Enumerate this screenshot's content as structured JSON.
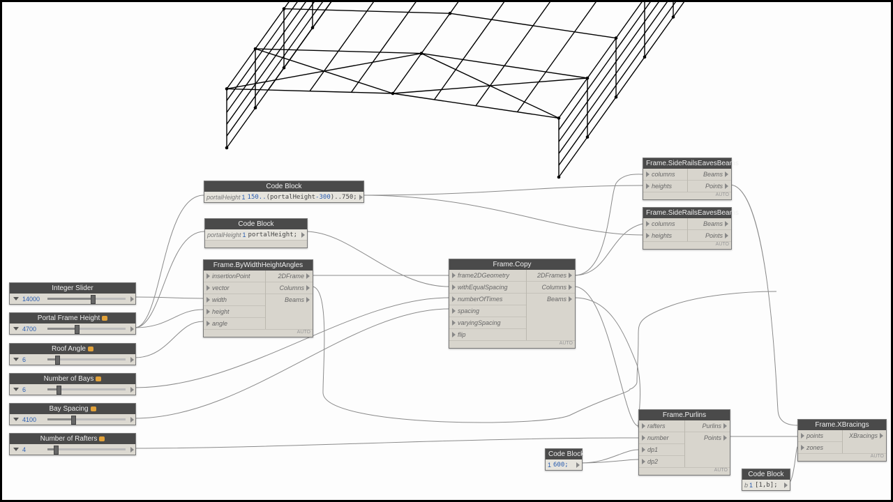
{
  "sliders": [
    {
      "label": "Integer Slider",
      "value": "14000",
      "fill": 0.55,
      "badge": false
    },
    {
      "label": "Portal Frame Height",
      "value": "4700",
      "fill": 0.35,
      "badge": true
    },
    {
      "label": "Roof Angle",
      "value": "6",
      "fill": 0.1,
      "badge": true
    },
    {
      "label": "Number of Bays",
      "value": "6",
      "fill": 0.12,
      "badge": true
    },
    {
      "label": "Bay Spacing",
      "value": "4100",
      "fill": 0.3,
      "badge": true
    },
    {
      "label": "Number of Rafters",
      "value": "4",
      "fill": 0.08,
      "badge": true
    }
  ],
  "cb1": {
    "title": "Code Block",
    "inLabel": "portalHeight",
    "ln": "1",
    "code_a": "150..",
    "code_b": "(portalHeight",
    "code_c": "-300",
    "code_d": ")..750;"
  },
  "cb2": {
    "title": "Code Block",
    "inLabel": "portalHeight",
    "ln": "1",
    "code": "portalHeight;"
  },
  "cb3": {
    "title": "Code Block",
    "ln": "1",
    "code": "600;"
  },
  "cb4": {
    "title": "Code Block",
    "inLabel": "b",
    "ln": "1",
    "code": "[1,b];"
  },
  "frameBy": {
    "title": "Frame.ByWidthHeightAngles",
    "ins": [
      "insertionPoint",
      "vector",
      "width",
      "height",
      "angle"
    ],
    "outs": [
      "2DFrame",
      "Columns",
      "Beams"
    ]
  },
  "frameCopy": {
    "title": "Frame.Copy",
    "ins": [
      "frame2DGeometry",
      "withEqualSpacing",
      "numberOfTimes",
      "spacing",
      "varyingSpacing",
      "flip"
    ],
    "outs": [
      "2DFrames",
      "Columns",
      "Beams"
    ]
  },
  "sre1": {
    "title": "Frame.SideRailsEavesBeams",
    "ins": [
      "columns",
      "heights"
    ],
    "outs": [
      "Beams",
      "Points"
    ]
  },
  "sre2": {
    "title": "Frame.SideRailsEavesBeams",
    "ins": [
      "columns",
      "heights"
    ],
    "outs": [
      "Beams",
      "Points"
    ]
  },
  "purlins": {
    "title": "Frame.Purlins",
    "ins": [
      "rafters",
      "number",
      "dp1",
      "dp2"
    ],
    "outs": [
      "Purlins",
      "Points"
    ]
  },
  "xbrac": {
    "title": "Frame.XBracings",
    "ins": [
      "points",
      "zones"
    ],
    "outs": [
      "XBracings"
    ]
  },
  "auto": "AUTO"
}
